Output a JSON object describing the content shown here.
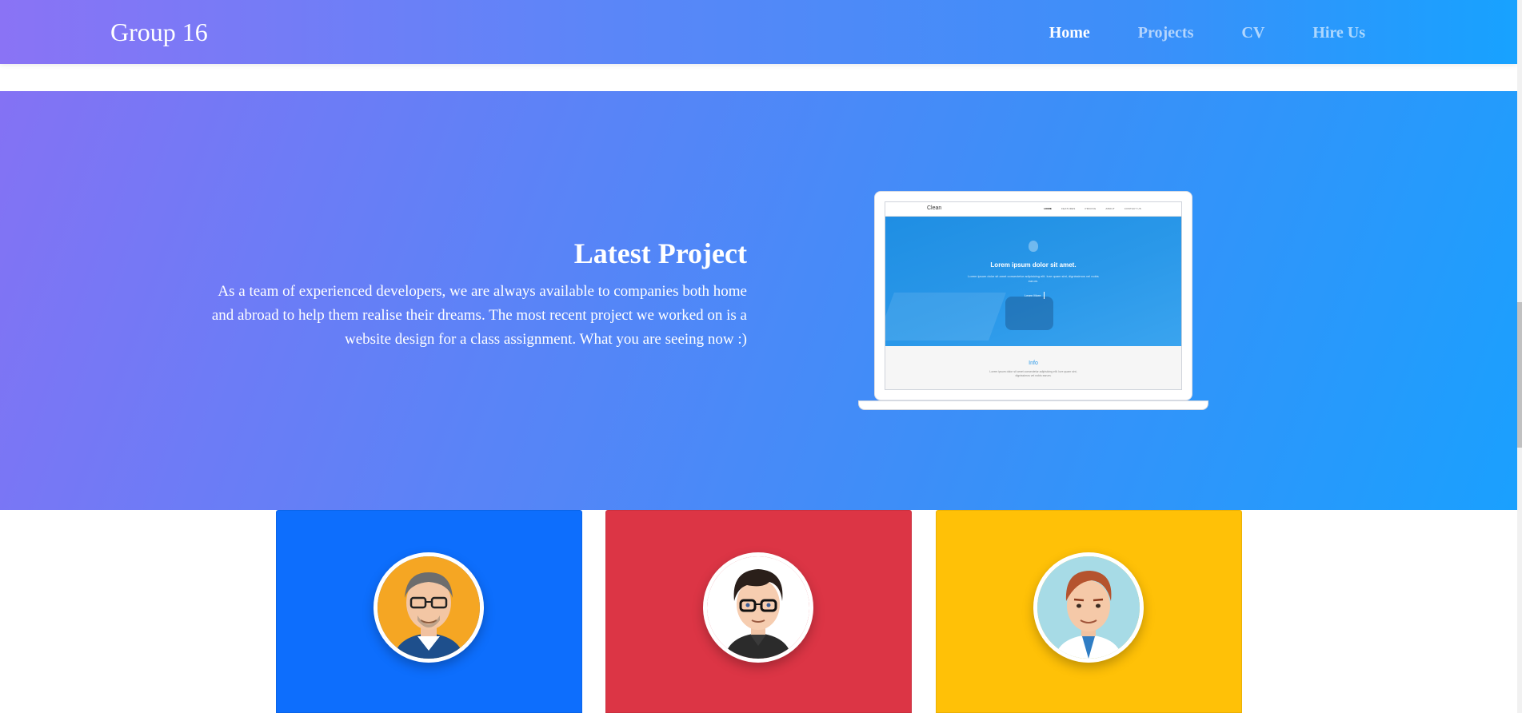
{
  "navbar": {
    "brand": "Group 16",
    "links": [
      {
        "label": "Home",
        "active": true
      },
      {
        "label": "Projects",
        "active": false
      },
      {
        "label": "CV",
        "active": false
      },
      {
        "label": "Hire Us",
        "active": false
      }
    ]
  },
  "hero": {
    "title": "Latest Project",
    "description": "As a team of experienced developers, we are always available to companies both home and abroad to help them realise their dreams. The most recent project we worked on is a website design for a class assignment. What you are seeing now :)"
  },
  "project_preview": {
    "brand": "Clean",
    "nav": [
      "HOME",
      "FEATURES",
      "PRICING",
      "ABOUT",
      "CONTACT US"
    ],
    "headline": "Lorem ipsum dolor sit amet.",
    "text": "Lorem ipsum dolor sit amet consectetur adipisicing elit. Iure quam sint, dignissimos vel nobis earum.",
    "button": "Learn More",
    "info_title": "Info",
    "info_text": "Lorem ipsum dolor sit amet consectetur adipisicing elit. Iure quam sint, dignissimos vel nobis earum."
  },
  "team_cards": [
    {
      "color": "#0d6efd",
      "avatar": "older-man-glasses-avatar"
    },
    {
      "color": "#dc3545",
      "avatar": "young-man-glasses-avatar"
    },
    {
      "color": "#ffc107",
      "avatar": "redhead-man-avatar"
    }
  ],
  "colors": {
    "gradient_start": "#8a73f5",
    "gradient_end": "#17a2ff",
    "nav_active": "#ffffff"
  }
}
